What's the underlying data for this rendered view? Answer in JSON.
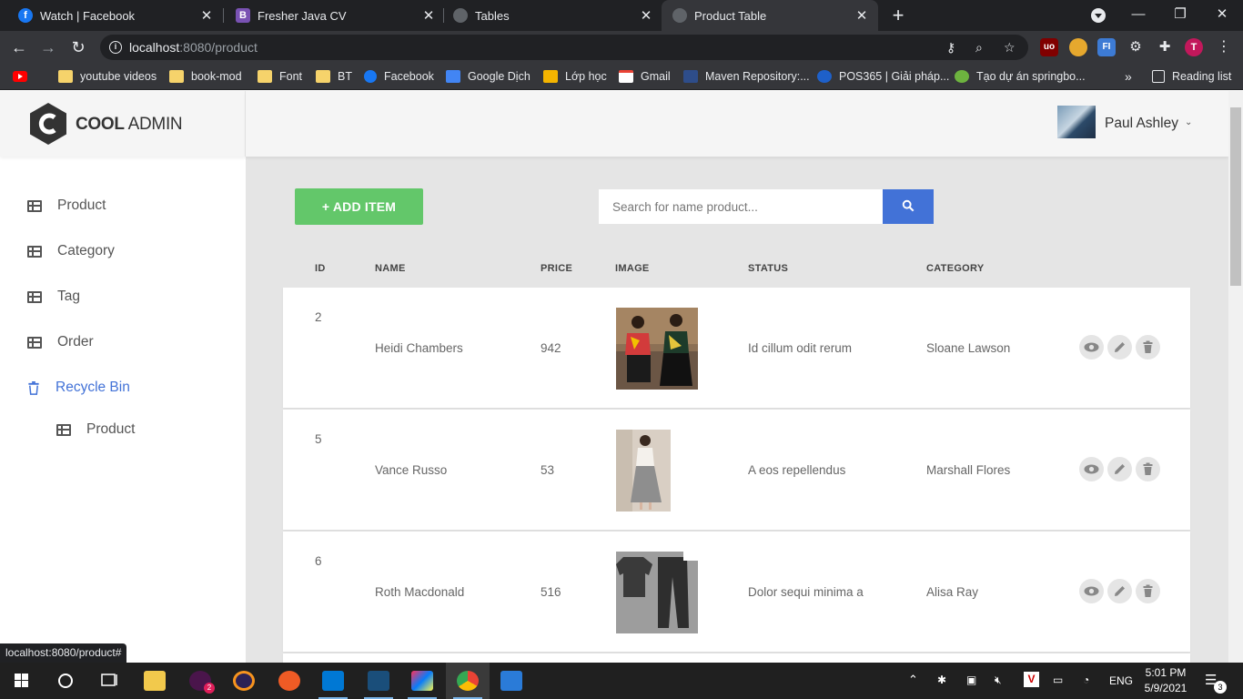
{
  "browser": {
    "tabs": [
      {
        "title": "Watch | Facebook",
        "icon": "facebook-icon",
        "active": false
      },
      {
        "title": "Fresher Java CV",
        "icon": "bootstrap-icon",
        "active": false
      },
      {
        "title": "Tables",
        "icon": "globe-icon",
        "active": false
      },
      {
        "title": "Product Table",
        "icon": "globe-icon",
        "active": true
      }
    ],
    "url_host": "localhost",
    "url_rest": ":8080/product",
    "bookmarks": [
      "youtube videos",
      "book-mod",
      "Font",
      "BT",
      "Facebook",
      "Google Dịch",
      "Lớp học",
      "Gmail",
      "Maven Repository:...",
      "POS365 | Giải pháp...",
      "Tạo dự án springbo..."
    ],
    "reading_list": "Reading list",
    "status_url": "localhost:8080/product#",
    "profile_initial": "T"
  },
  "app": {
    "logo_bold": "COOL",
    "logo_light": " ADMIN",
    "user_name": "Paul Ashley",
    "menu": {
      "product": "Product",
      "category": "Category",
      "tag": "Tag",
      "order": "Order",
      "recycle_bin": "Recycle Bin",
      "recycle_product": "Product"
    },
    "add_item": "+ ADD ITEM",
    "search_placeholder": "Search for name product...",
    "table": {
      "headers": {
        "id": "ID",
        "name": "NAME",
        "price": "PRICE",
        "image": "IMAGE",
        "status": "STATUS",
        "category": "CATEGORY"
      },
      "rows": [
        {
          "id": "2",
          "name": "Heidi Chambers",
          "price": "942",
          "status": "Id cillum odit rerum",
          "category": "Sloane Lawson"
        },
        {
          "id": "5",
          "name": "Vance Russo",
          "price": "53",
          "status": "A eos repellendus",
          "category": "Marshall Flores"
        },
        {
          "id": "6",
          "name": "Roth Macdonald",
          "price": "516",
          "status": "Dolor sequi minima a",
          "category": "Alisa Ray"
        }
      ]
    }
  },
  "taskbar": {
    "language": "ENG",
    "time": "5:01 PM",
    "date": "5/9/2021",
    "notifications": "3",
    "slack_badge": "2"
  },
  "colors": {
    "accent": "#4272d7",
    "add_button": "#63c76a",
    "page_bg": "#e5e5e5"
  }
}
